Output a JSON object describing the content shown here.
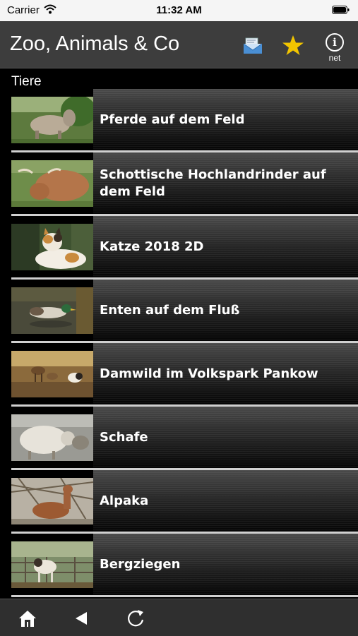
{
  "status": {
    "carrier": "Carrier",
    "time": "11:32 AM"
  },
  "navbar": {
    "title": "Zoo, Animals & Co",
    "info_label": "net",
    "info_glyph": "i",
    "accent": "#f2c500"
  },
  "section": {
    "title": "Tiere"
  },
  "items": [
    {
      "title": "Pferde auf dem Feld"
    },
    {
      "title": "Schottische Hochlandrinder auf dem Feld"
    },
    {
      "title": "Katze 2018 2D"
    },
    {
      "title": "Enten auf dem Fluß"
    },
    {
      "title": "Damwild im Volkspark Pankow"
    },
    {
      "title": "Schafe"
    },
    {
      "title": "Alpaka"
    },
    {
      "title": "Bergziegen"
    }
  ],
  "tabbar": {
    "icons": [
      "home-icon",
      "back-icon",
      "reload-icon"
    ]
  }
}
